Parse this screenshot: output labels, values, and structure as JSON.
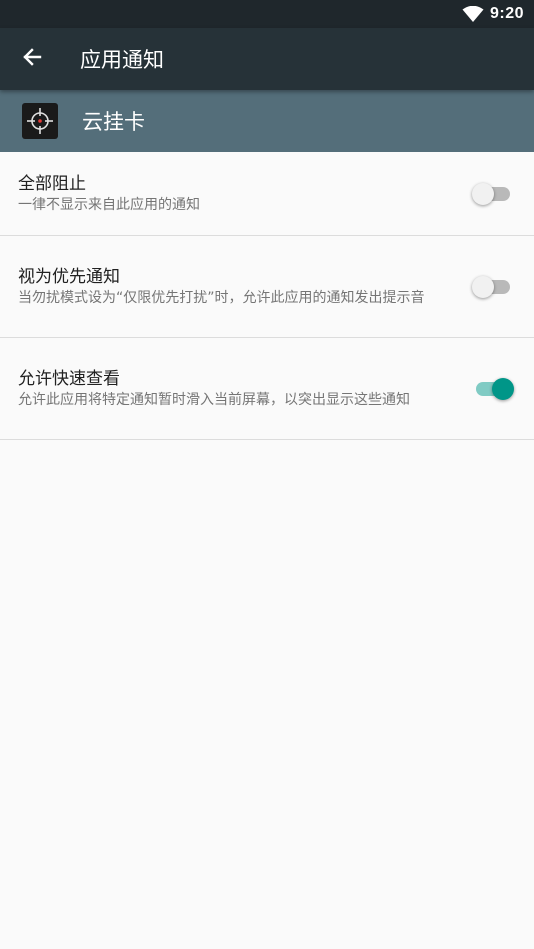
{
  "status_bar": {
    "time": "9:20",
    "wifi_icon": "wifi-icon"
  },
  "app_bar": {
    "back_icon": "arrow-back-icon",
    "title": "应用通知"
  },
  "app_header": {
    "icon": "crosshair-app-icon",
    "name": "云挂卡"
  },
  "settings": [
    {
      "title": "全部阻止",
      "subtitle": "一律不显示来自此应用的通知",
      "enabled": false
    },
    {
      "title": "视为优先通知",
      "subtitle": "当勿扰模式设为“仅限优先打扰”时，允许此应用的通知发出提示音",
      "enabled": false
    },
    {
      "title": "允许快速查看",
      "subtitle": "允许此应用将特定通知暂时滑入当前屏幕，以突出显示这些通知",
      "enabled": true
    }
  ],
  "colors": {
    "status_bar": "#1f272c",
    "app_bar": "#263238",
    "app_header": "#546e7a",
    "accent": "#009688"
  }
}
